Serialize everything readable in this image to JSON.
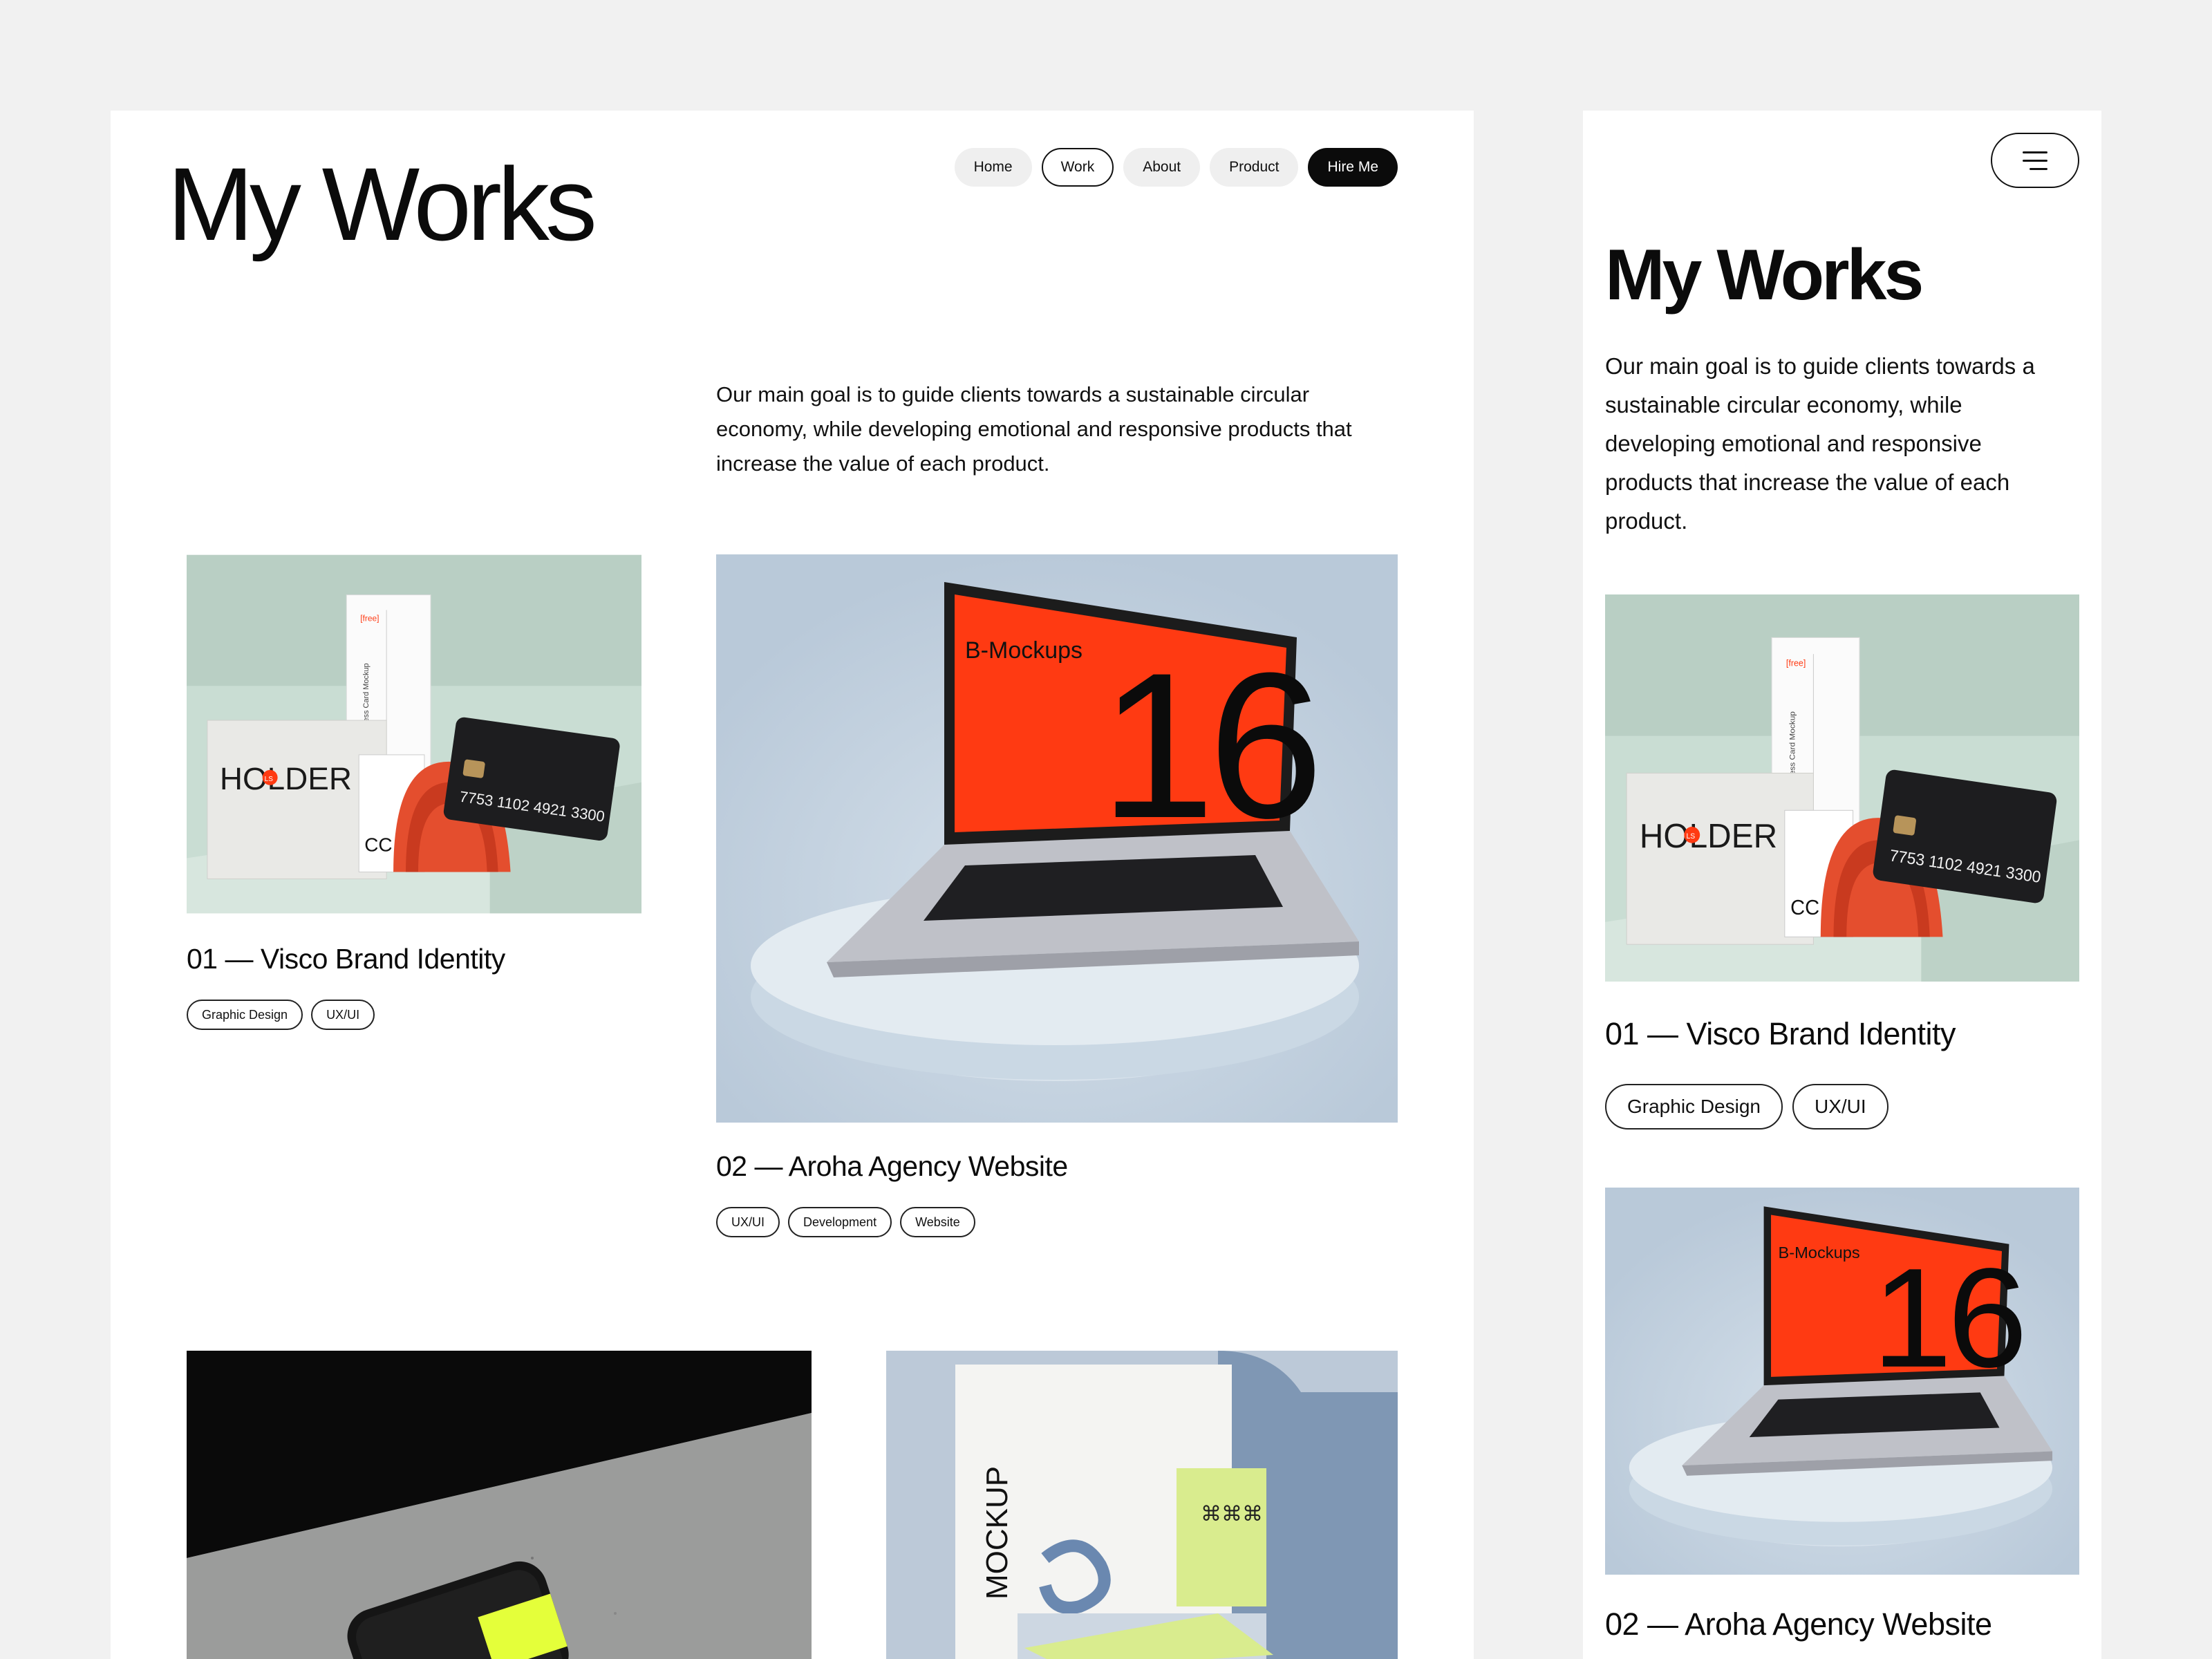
{
  "desktop": {
    "title": "My Works",
    "nav": {
      "home": "Home",
      "work": "Work",
      "about": "About",
      "product": "Product",
      "hire": "Hire Me"
    },
    "intro": "Our main goal is to guide clients towards a sustainable circular economy, while developing emotional and responsive products that increase the value of each product.",
    "projects": [
      {
        "title": "01 — Visco Brand Identity",
        "tags": [
          "Graphic Design",
          "UX/UI"
        ]
      },
      {
        "title": "02 — Aroha Agency Website",
        "tags": [
          "UX/UI",
          "Development",
          "Website"
        ]
      }
    ]
  },
  "mobile": {
    "title": "My Works",
    "intro": "Our main goal is to guide clients towards a sustainable circular economy, while developing emotional and responsive products that increase the value of each product.",
    "projects": [
      {
        "title": "01 — Visco Brand Identity",
        "tags": [
          "Graphic Design",
          "UX/UI"
        ]
      },
      {
        "title": "02 — Aroha Agency Website"
      }
    ]
  },
  "mockups": {
    "holder": {
      "brand": "HOLDER",
      "badge": "LS",
      "cc": "CC",
      "card_number": "7753  1102  4921  3300",
      "note_title": "Business Card Mockup",
      "note_tag": "[free]"
    },
    "laptop": {
      "brand": "B-Mockups",
      "number": "16"
    },
    "stationery": {
      "vertical": "MOCKUP",
      "glyphs": "⌘⌘⌘"
    }
  },
  "colors": {
    "accent_red": "#ff3a12",
    "mint": "#c9ddd3",
    "sky": "#c3d2e0",
    "lime": "#d9ec8e"
  }
}
